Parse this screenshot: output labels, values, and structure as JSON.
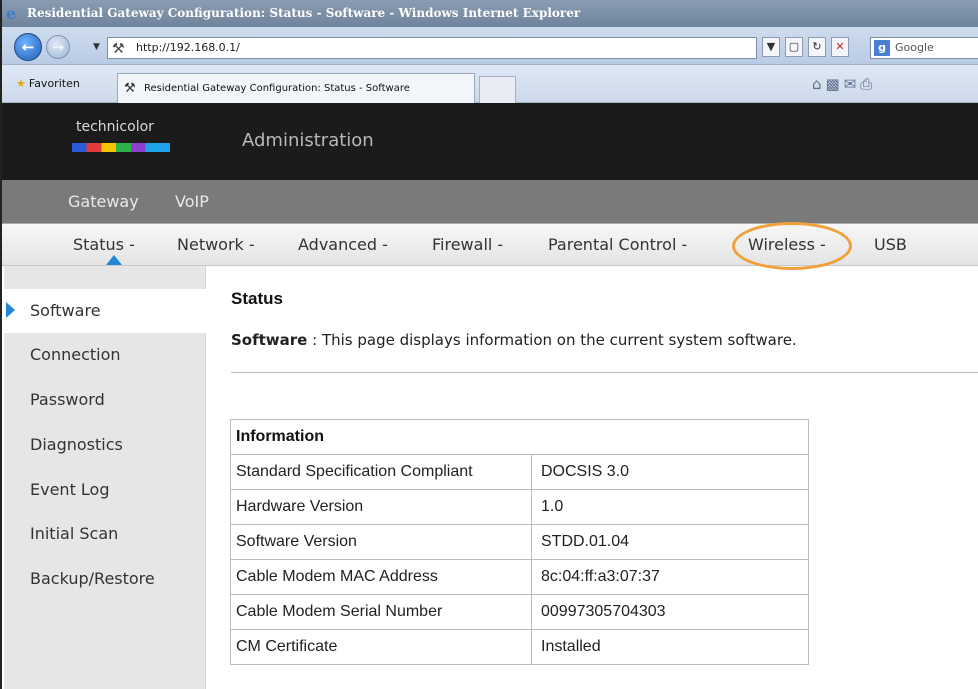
{
  "browser": {
    "window_title": "Residential Gateway Configuration: Status - Software - Windows Internet Explorer",
    "url": "http://192.168.0.1/",
    "search_placeholder": "Google",
    "favorites_label": "Favoriten",
    "tab_title": "Residential Gateway Configuration: Status - Software"
  },
  "header": {
    "brand": "technicolor",
    "title": "Administration"
  },
  "top_menu": [
    "Gateway",
    "VoIP"
  ],
  "sub_menu": {
    "status": "Status -",
    "network": "Network -",
    "advanced": "Advanced -",
    "firewall": "Firewall -",
    "parental": "Parental Control -",
    "wireless": "Wireless -",
    "usb": "USB"
  },
  "sidebar": [
    "Software",
    "Connection",
    "Password",
    "Diagnostics",
    "Event Log",
    "Initial Scan",
    "Backup/Restore"
  ],
  "main": {
    "heading": "Status",
    "desc_label": "Software",
    "desc_sep": " : ",
    "desc_text": "This page displays information on the current system software."
  },
  "info_table": {
    "header": "Information",
    "rows": [
      [
        "Standard Specification Compliant",
        "DOCSIS 3.0"
      ],
      [
        "Hardware Version",
        "1.0"
      ],
      [
        "Software Version",
        "STDD.01.04"
      ],
      [
        "Cable Modem MAC Address",
        "8c:04:ff:a3:07:37"
      ],
      [
        "Cable Modem Serial Number",
        "00997305704303"
      ],
      [
        "CM Certificate",
        "Installed"
      ]
    ]
  },
  "colors": {
    "accent": "#1f86d8",
    "highlight": "#f1a03a"
  }
}
